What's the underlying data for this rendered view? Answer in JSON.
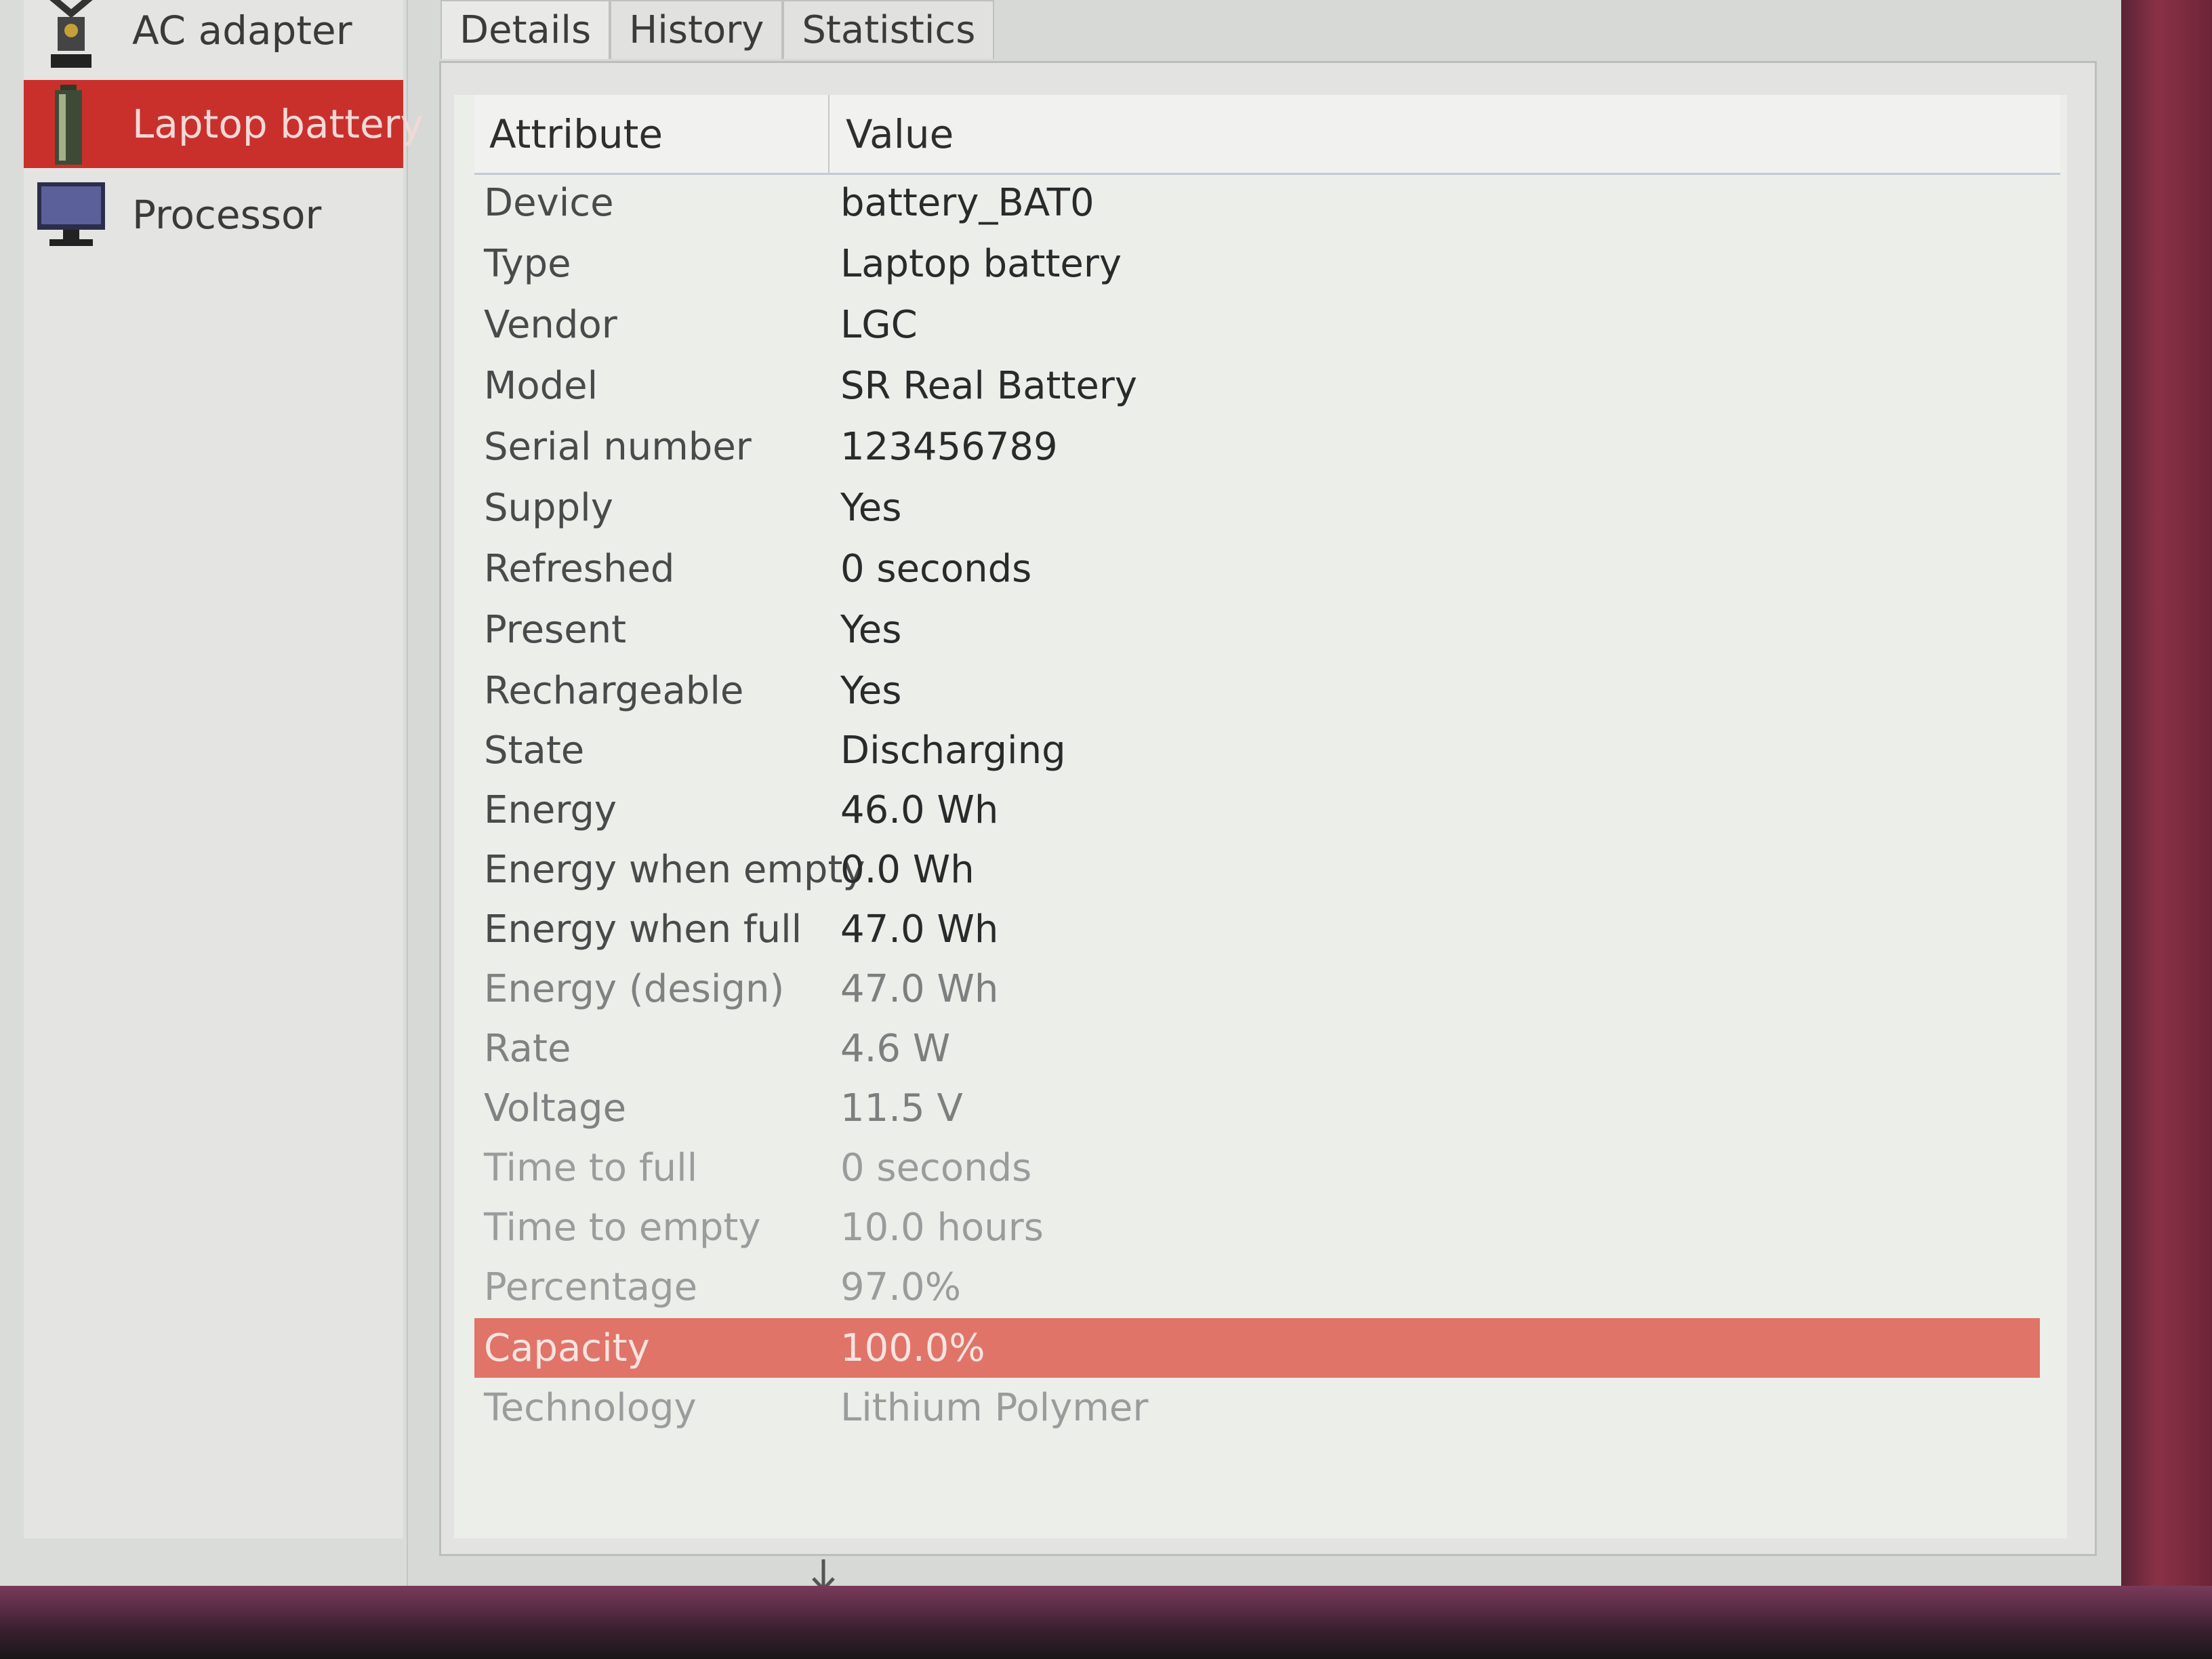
{
  "sidebar": {
    "items": [
      {
        "label": "AC adapter",
        "icon": "ac-adapter-icon",
        "selected": false
      },
      {
        "label": "Laptop battery",
        "icon": "battery-icon",
        "selected": true
      },
      {
        "label": "Processor",
        "icon": "processor-icon",
        "selected": false
      }
    ]
  },
  "tabs": [
    {
      "label": "Details",
      "active": true
    },
    {
      "label": "History",
      "active": false
    },
    {
      "label": "Statistics",
      "active": false
    }
  ],
  "table": {
    "headers": {
      "attribute": "Attribute",
      "value": "Value"
    },
    "rows": [
      {
        "attribute": "Device",
        "value": "battery_BAT0"
      },
      {
        "attribute": "Type",
        "value": "Laptop battery"
      },
      {
        "attribute": "Vendor",
        "value": "LGC"
      },
      {
        "attribute": "Model",
        "value": "SR Real Battery"
      },
      {
        "attribute": "Serial number",
        "value": "123456789"
      },
      {
        "attribute": "Supply",
        "value": "Yes"
      },
      {
        "attribute": "Refreshed",
        "value": "0 seconds"
      },
      {
        "attribute": "Present",
        "value": "Yes"
      },
      {
        "attribute": "Rechargeable",
        "value": "Yes"
      },
      {
        "attribute": "State",
        "value": "Discharging"
      },
      {
        "attribute": "Energy",
        "value": "46.0 Wh"
      },
      {
        "attribute": "Energy when empty",
        "value": "0.0 Wh"
      },
      {
        "attribute": "Energy when full",
        "value": "47.0 Wh"
      },
      {
        "attribute": "Energy (design)",
        "value": "47.0 Wh"
      },
      {
        "attribute": "Rate",
        "value": "4.6 W"
      },
      {
        "attribute": "Voltage",
        "value": "11.5 V"
      },
      {
        "attribute": "Time to full",
        "value": "0 seconds"
      },
      {
        "attribute": "Time to empty",
        "value": "10.0 hours"
      },
      {
        "attribute": "Percentage",
        "value": "97.0%"
      },
      {
        "attribute": "Capacity",
        "value": "100.0%",
        "selected": true
      },
      {
        "attribute": "Technology",
        "value": "Lithium Polymer"
      }
    ]
  },
  "colors": {
    "selection": "#c9302c",
    "row_selection": "#e07468",
    "desktop": "#6b2a3e"
  }
}
